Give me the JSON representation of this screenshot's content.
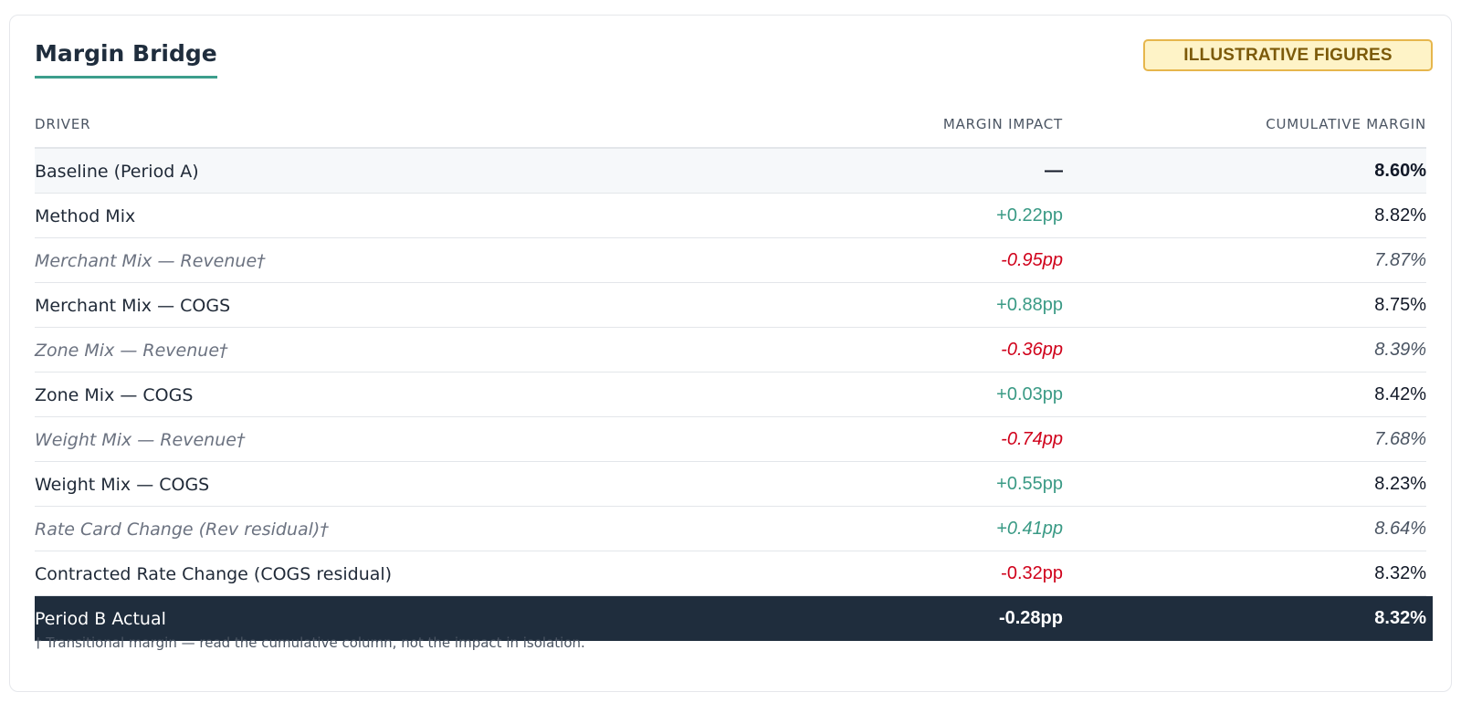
{
  "title": "Margin Bridge",
  "badge": "ILLUSTRATIVE FIGURES",
  "columns": {
    "driver": "DRIVER",
    "impact": "MARGIN IMPACT",
    "cumulative": "CUMULATIVE MARGIN"
  },
  "baseline": {
    "driver": "Baseline (Period A)",
    "impact": "—",
    "cumulative": "8.60%"
  },
  "rows": [
    {
      "driver": "Method Mix",
      "impact": "+0.22pp",
      "cumulative": "8.82%"
    },
    {
      "driver": "Merchant Mix — Revenue†",
      "impact": "-0.95pp",
      "cumulative": "7.87%"
    },
    {
      "driver": "Merchant Mix — COGS",
      "impact": "+0.88pp",
      "cumulative": "8.75%"
    },
    {
      "driver": "Zone Mix — Revenue†",
      "impact": "-0.36pp",
      "cumulative": "8.39%"
    },
    {
      "driver": "Zone Mix — COGS",
      "impact": "+0.03pp",
      "cumulative": "8.42%"
    },
    {
      "driver": "Weight Mix — Revenue†",
      "impact": "-0.74pp",
      "cumulative": "7.68%"
    },
    {
      "driver": "Weight Mix — COGS",
      "impact": "+0.55pp",
      "cumulative": "8.23%"
    },
    {
      "driver": "Rate Card Change (Rev residual)†",
      "impact": "+0.41pp",
      "cumulative": "8.64%"
    },
    {
      "driver": "Contracted Rate Change (COGS residual)",
      "impact": "-0.32pp",
      "cumulative": "8.32%"
    }
  ],
  "total": {
    "driver": "Period B Actual",
    "impact": "-0.28pp",
    "cumulative": "8.32%"
  },
  "footnote": "† Transitional margin — read the cumulative column, not the impact in isolation.",
  "colors": {
    "positive": "#3a9a85",
    "negative": "#d0021b",
    "total_bg": "#1f2d3d",
    "accent": "#3d9e8c",
    "badge_bg": "#fef3c7",
    "badge_border": "#e6b64c"
  }
}
